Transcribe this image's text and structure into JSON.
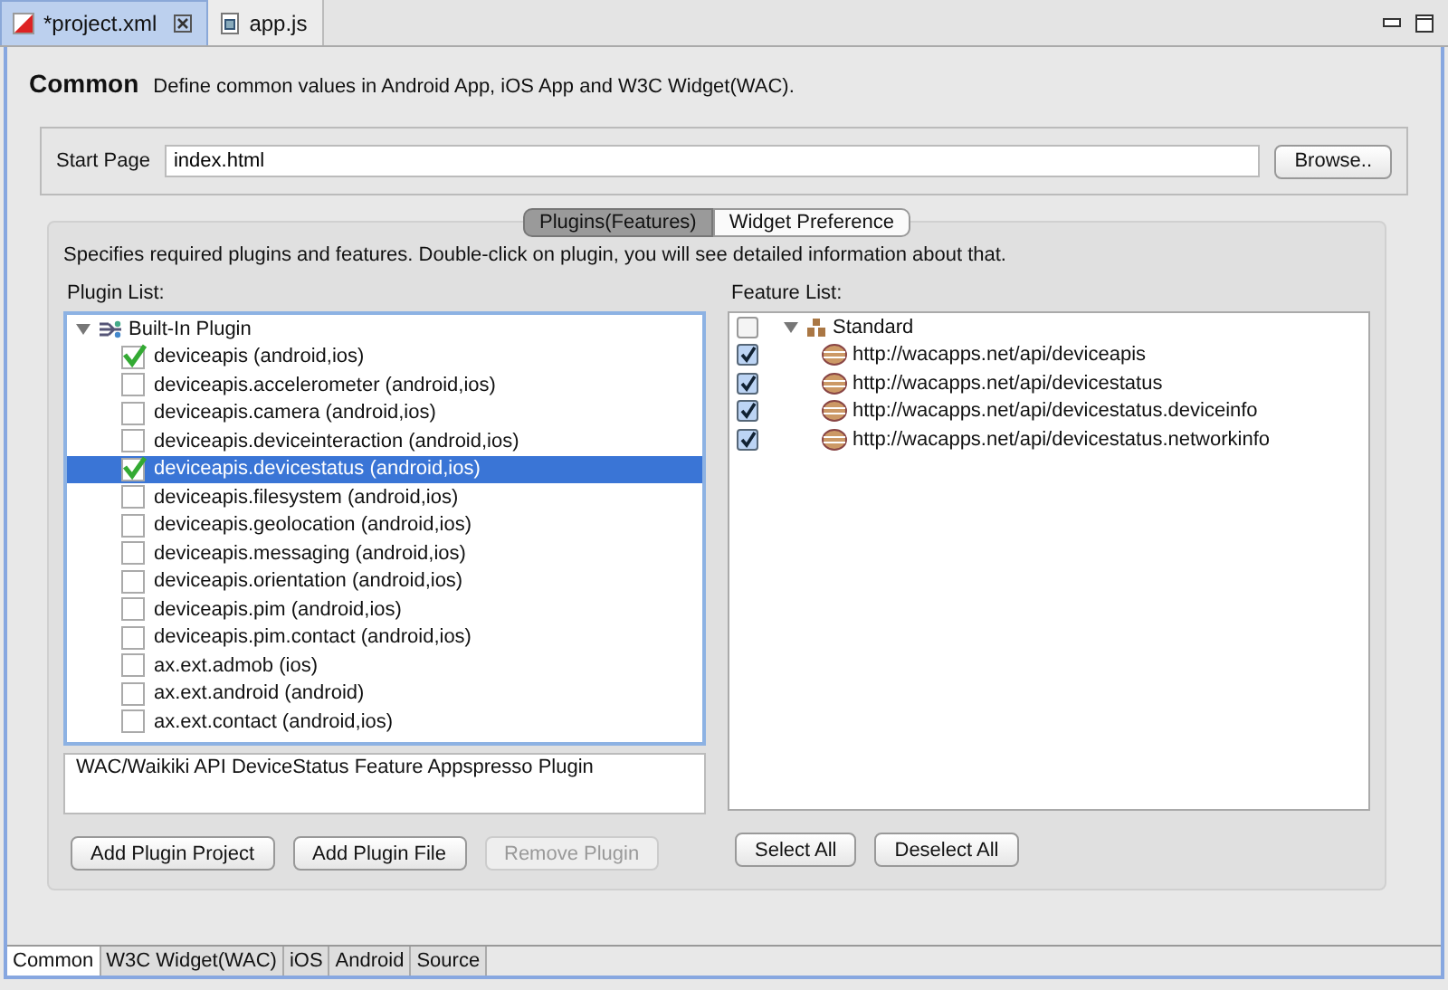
{
  "editor_tabs": [
    {
      "label": "*project.xml",
      "selected": true,
      "closable": true,
      "kind": "xml"
    },
    {
      "label": "app.js",
      "selected": false,
      "closable": false,
      "kind": "js"
    }
  ],
  "header": {
    "title": "Common",
    "description": "Define common values in Android App, iOS App and W3C Widget(WAC)."
  },
  "start_page": {
    "label": "Start Page",
    "value": "index.html",
    "button": "Browse.."
  },
  "section_tabs": [
    {
      "label": "Plugins(Features)",
      "selected": true
    },
    {
      "label": "Widget Preference",
      "selected": false
    }
  ],
  "instructions": "Specifies required plugins and features. Double-click on plugin, you will see detailed information about that.",
  "plugin_list": {
    "label": "Plugin List:",
    "items": [
      {
        "label": "Built-In Plugin",
        "expanded": true,
        "children": [
          {
            "label": "deviceapis (android,ios)",
            "checked": true,
            "selected": false
          },
          {
            "label": "deviceapis.accelerometer (android,ios)",
            "checked": false,
            "selected": false
          },
          {
            "label": "deviceapis.camera (android,ios)",
            "checked": false,
            "selected": false
          },
          {
            "label": "deviceapis.deviceinteraction (android,ios)",
            "checked": false,
            "selected": false
          },
          {
            "label": "deviceapis.devicestatus (android,ios)",
            "checked": true,
            "selected": true
          },
          {
            "label": "deviceapis.filesystem (android,ios)",
            "checked": false,
            "selected": false
          },
          {
            "label": "deviceapis.geolocation (android,ios)",
            "checked": false,
            "selected": false
          },
          {
            "label": "deviceapis.messaging (android,ios)",
            "checked": false,
            "selected": false
          },
          {
            "label": "deviceapis.orientation (android,ios)",
            "checked": false,
            "selected": false
          },
          {
            "label": "deviceapis.pim (android,ios)",
            "checked": false,
            "selected": false
          },
          {
            "label": "deviceapis.pim.contact (android,ios)",
            "checked": false,
            "selected": false
          },
          {
            "label": "ax.ext.admob (ios)",
            "checked": false,
            "selected": false
          },
          {
            "label": "ax.ext.android (android)",
            "checked": false,
            "selected": false
          },
          {
            "label": "ax.ext.contact (android,ios)",
            "checked": false,
            "selected": false
          }
        ]
      }
    ],
    "description": "WAC/Waikiki API DeviceStatus Feature Appspresso Plugin",
    "buttons": [
      {
        "label": "Add Plugin Project",
        "disabled": false
      },
      {
        "label": "Add Plugin File",
        "disabled": false
      },
      {
        "label": "Remove Plugin",
        "disabled": true
      }
    ]
  },
  "feature_list": {
    "label": "Feature List:",
    "items": [
      {
        "label": "Standard",
        "checked": false,
        "expanded": true,
        "children": [
          {
            "label": "http://wacapps.net/api/deviceapis",
            "checked": true
          },
          {
            "label": "http://wacapps.net/api/devicestatus",
            "checked": true
          },
          {
            "label": "http://wacapps.net/api/devicestatus.deviceinfo",
            "checked": true
          },
          {
            "label": "http://wacapps.net/api/devicestatus.networkinfo",
            "checked": true
          }
        ]
      }
    ],
    "buttons": [
      {
        "label": "Select All",
        "disabled": false
      },
      {
        "label": "Deselect All",
        "disabled": false
      }
    ]
  },
  "bottom_tabs": [
    {
      "label": "Common",
      "selected": true
    },
    {
      "label": "W3C Widget(WAC)",
      "selected": false
    },
    {
      "label": "iOS",
      "selected": false
    },
    {
      "label": "Android",
      "selected": false
    },
    {
      "label": "Source",
      "selected": false
    }
  ]
}
